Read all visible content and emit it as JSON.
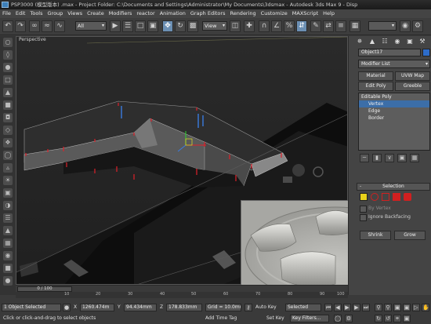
{
  "window": {
    "title": "PSP3000 (模型版本) .max  - Project Folder: C:\\Documents and Settings\\Administrator\\My Documents\\3dsmax  - Autodesk 3ds Max 9  - Disp"
  },
  "menu": [
    "File",
    "Edit",
    "Tools",
    "Group",
    "Views",
    "Create",
    "Modifiers",
    "reactor",
    "Animation",
    "Graph Editors",
    "Rendering",
    "Customize",
    "MAXScript",
    "Help"
  ],
  "toolbar": {
    "filter": "All",
    "reference_coord": "View"
  },
  "viewport": {
    "label": "Perspective"
  },
  "command_panel": {
    "object_name": "Object17",
    "modifier_list": "Modifier List",
    "buttons": [
      "Material",
      "UVW Map",
      "Edit Poly",
      "Greeble"
    ],
    "stack": [
      {
        "label": "Editable Poly",
        "selected": false,
        "sub": false
      },
      {
        "label": "Vertex",
        "selected": true,
        "sub": true
      },
      {
        "label": "Edge",
        "selected": false,
        "sub": true
      },
      {
        "label": "Border",
        "selected": false,
        "sub": true
      }
    ],
    "selection_rollout": "Selection",
    "checkboxes": [
      {
        "label": "By Vertex",
        "dim": true
      },
      {
        "label": "Ignore Backfacing",
        "dim": false
      }
    ],
    "shrink": "Shrink",
    "grow": "Grow"
  },
  "time": {
    "slider": "0 / 100",
    "ticks": [
      "10",
      "20",
      "30",
      "40",
      "50",
      "60",
      "70",
      "80",
      "90",
      "100"
    ]
  },
  "status": {
    "selection": "1 Object Selected",
    "x_label": "X",
    "x_value": "1260.474m",
    "y_label": "Y",
    "y_value": "94.434mm",
    "z_label": "Z",
    "z_value": "178.833mm",
    "grid": "Grid = 10.0mm",
    "autokey": "Auto Key",
    "autokey_mode": "Selected",
    "setkey": "Set Key",
    "key_filters": "Key Filters...",
    "prompt": "Click or click-and-drag to select objects",
    "add_time_tag": "Add Time Tag"
  },
  "colors": {
    "selection_blue": "#3c6ea8",
    "vertex_red": "#e0202a"
  }
}
